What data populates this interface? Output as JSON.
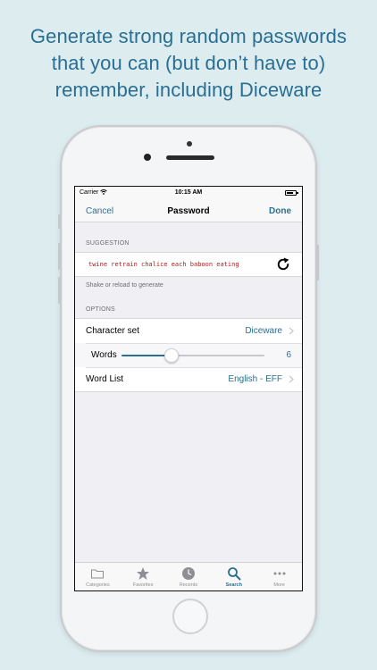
{
  "headline": {
    "line1": "Generate strong random passwords",
    "line2": "that you can (but don’t have to)",
    "line3": "remember, including Diceware"
  },
  "status_bar": {
    "carrier": "Carrier",
    "time": "10:15 AM",
    "battery_level": 0.8
  },
  "nav": {
    "cancel_label": "Cancel",
    "title": "Password",
    "done_label": "Done"
  },
  "suggestion": {
    "header": "SUGGESTION",
    "text": "twine retrain chalice each baboon eating",
    "footer": "Shake or reload to generate",
    "refresh_icon": "refresh-icon"
  },
  "options": {
    "header": "OPTIONS",
    "character_set": {
      "label": "Character set",
      "value": "Diceware"
    },
    "words": {
      "label": "Words",
      "value": "6",
      "slider_fraction": 0.35
    },
    "word_list": {
      "label": "Word List",
      "value": "English - EFF"
    }
  },
  "tabs": [
    {
      "label": "Categories",
      "icon": "folder-icon",
      "active": false
    },
    {
      "label": "Favorites",
      "icon": "star-icon",
      "active": false
    },
    {
      "label": "Recents",
      "icon": "clock-icon",
      "active": false
    },
    {
      "label": "Search",
      "icon": "search-icon",
      "active": true
    },
    {
      "label": "More",
      "icon": "more-icon",
      "active": false
    }
  ],
  "colors": {
    "accent": "#2a6f93",
    "password_text": "#a52121",
    "background": "#dcecef"
  }
}
